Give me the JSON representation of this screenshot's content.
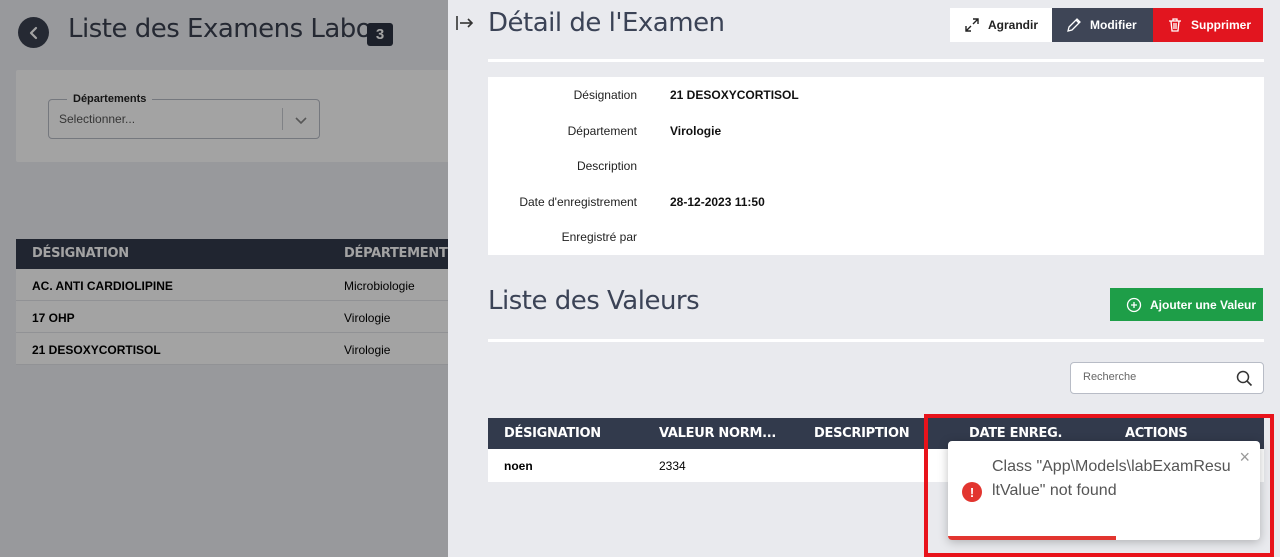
{
  "list_page": {
    "title": "Liste des Examens Labo",
    "count": "3",
    "filter": {
      "legend": "Départements",
      "placeholder": "Selectionner..."
    },
    "table": {
      "headers": [
        "DÉSIGNATION",
        "DÉPARTEMENT"
      ],
      "rows": [
        {
          "designation": "AC. ANTI CARDIOLIPINE",
          "departement": "Microbiologie"
        },
        {
          "designation": "17 OHP",
          "departement": "Virologie"
        },
        {
          "designation": "21 DESOXYCORTISOL",
          "departement": "Virologie"
        }
      ]
    }
  },
  "detail": {
    "title": "Détail de l'Examen",
    "buttons": {
      "expand": "Agrandir",
      "edit": "Modifier",
      "delete": "Supprimer"
    },
    "fields": [
      {
        "label": "Désignation",
        "value": "21 DESOXYCORTISOL"
      },
      {
        "label": "Département",
        "value": "Virologie"
      },
      {
        "label": "Description",
        "value": ""
      },
      {
        "label": "Date d'enregistrement",
        "value": "28-12-2023 11:50"
      },
      {
        "label": "Enregistré par",
        "value": ""
      }
    ]
  },
  "values": {
    "title": "Liste des Valeurs",
    "add_button": "Ajouter une Valeur",
    "search_placeholder": "Recherche",
    "table": {
      "headers": [
        "DÉSIGNATION",
        "VALEUR NORM...",
        "DESCRIPTION",
        "DATE ENREG.",
        "ACTIONS"
      ],
      "rows": [
        {
          "designation": "noen",
          "valeur": "2334",
          "description": "",
          "date": "",
          "actions": ""
        }
      ]
    }
  },
  "toast": {
    "message": "Class \"App\\Models\\labExamResultValue\" not found",
    "icon": "error-icon",
    "progress": 0.54
  },
  "colors": {
    "danger": "#e2151f",
    "success": "#1e9e48",
    "dark": "#323a4c",
    "highlight": "#e8131b"
  }
}
